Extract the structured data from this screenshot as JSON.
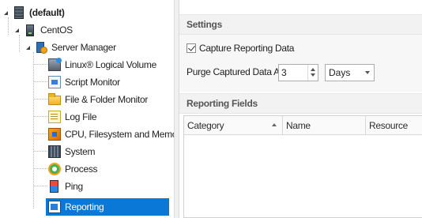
{
  "tree": {
    "root": {
      "label": "(default)",
      "icon": "server-rack-icon"
    },
    "host": {
      "label": "CentOS",
      "icon": "server-icon"
    },
    "manager": {
      "label": "Server Manager",
      "icon": "server-manager-icon"
    },
    "items": [
      {
        "label": "Linux® Logical Volume",
        "icon": "logical-volume-icon"
      },
      {
        "label": "Script Monitor",
        "icon": "script-monitor-icon"
      },
      {
        "label": "File & Folder Monitor",
        "icon": "folder-icon"
      },
      {
        "label": "Log File",
        "icon": "log-file-icon"
      },
      {
        "label": "CPU, Filesystem and Memory",
        "icon": "cpu-icon"
      },
      {
        "label": "System",
        "icon": "system-icon"
      },
      {
        "label": "Process",
        "icon": "process-icon"
      },
      {
        "label": "Ping",
        "icon": "ping-icon"
      },
      {
        "label": "Reporting",
        "icon": "reporting-icon",
        "selected": true
      }
    ]
  },
  "settings": {
    "header": "Settings",
    "capture_label": "Capture Reporting Data",
    "capture_checked": true,
    "purge_label": "Purge Captured Data After:",
    "purge_value": "3",
    "purge_unit": "Days"
  },
  "reporting_fields": {
    "header": "Reporting Fields",
    "columns": [
      "Category",
      "Name",
      "Resource"
    ],
    "sort_column": "Category",
    "sort_direction": "ascending",
    "rows": []
  }
}
